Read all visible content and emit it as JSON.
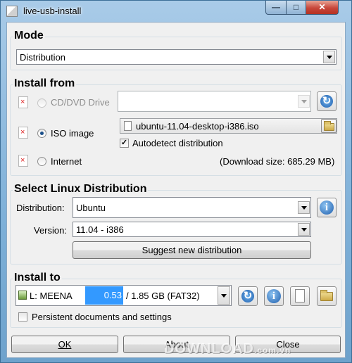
{
  "window": {
    "title": "live-usb-install"
  },
  "mode": {
    "heading": "Mode",
    "selected": "Distribution"
  },
  "install_from": {
    "heading": "Install from",
    "cd_label": "CD/DVD Drive",
    "iso_label": "ISO image",
    "internet_label": "Internet",
    "iso_file": "ubuntu-11.04-desktop-i386.iso",
    "autodetect_label": "Autodetect distribution",
    "autodetect_checked": true,
    "download_size": "(Download size: 685.29 MB)"
  },
  "select_distro": {
    "heading": "Select Linux Distribution",
    "distribution_label": "Distribution:",
    "distribution_value": "Ubuntu",
    "version_label": "Version:",
    "version_value": "11.04 - i386",
    "suggest_label": "Suggest new distribution"
  },
  "install_to": {
    "heading": "Install to",
    "drive": "L: MEENA",
    "free_fraction": "0.53",
    "capacity": "/ 1.85 GB (FAT32)",
    "persistent_label": "Persistent documents and settings"
  },
  "buttons": {
    "ok": "OK",
    "about": "About",
    "close": "Close"
  },
  "watermark": {
    "main": "DOWNLOAD",
    "suffix": ".com.vn"
  },
  "colors": {
    "titlebar": "#7eb0d8",
    "selection": "#3399ff",
    "close_button": "#c7463a"
  }
}
